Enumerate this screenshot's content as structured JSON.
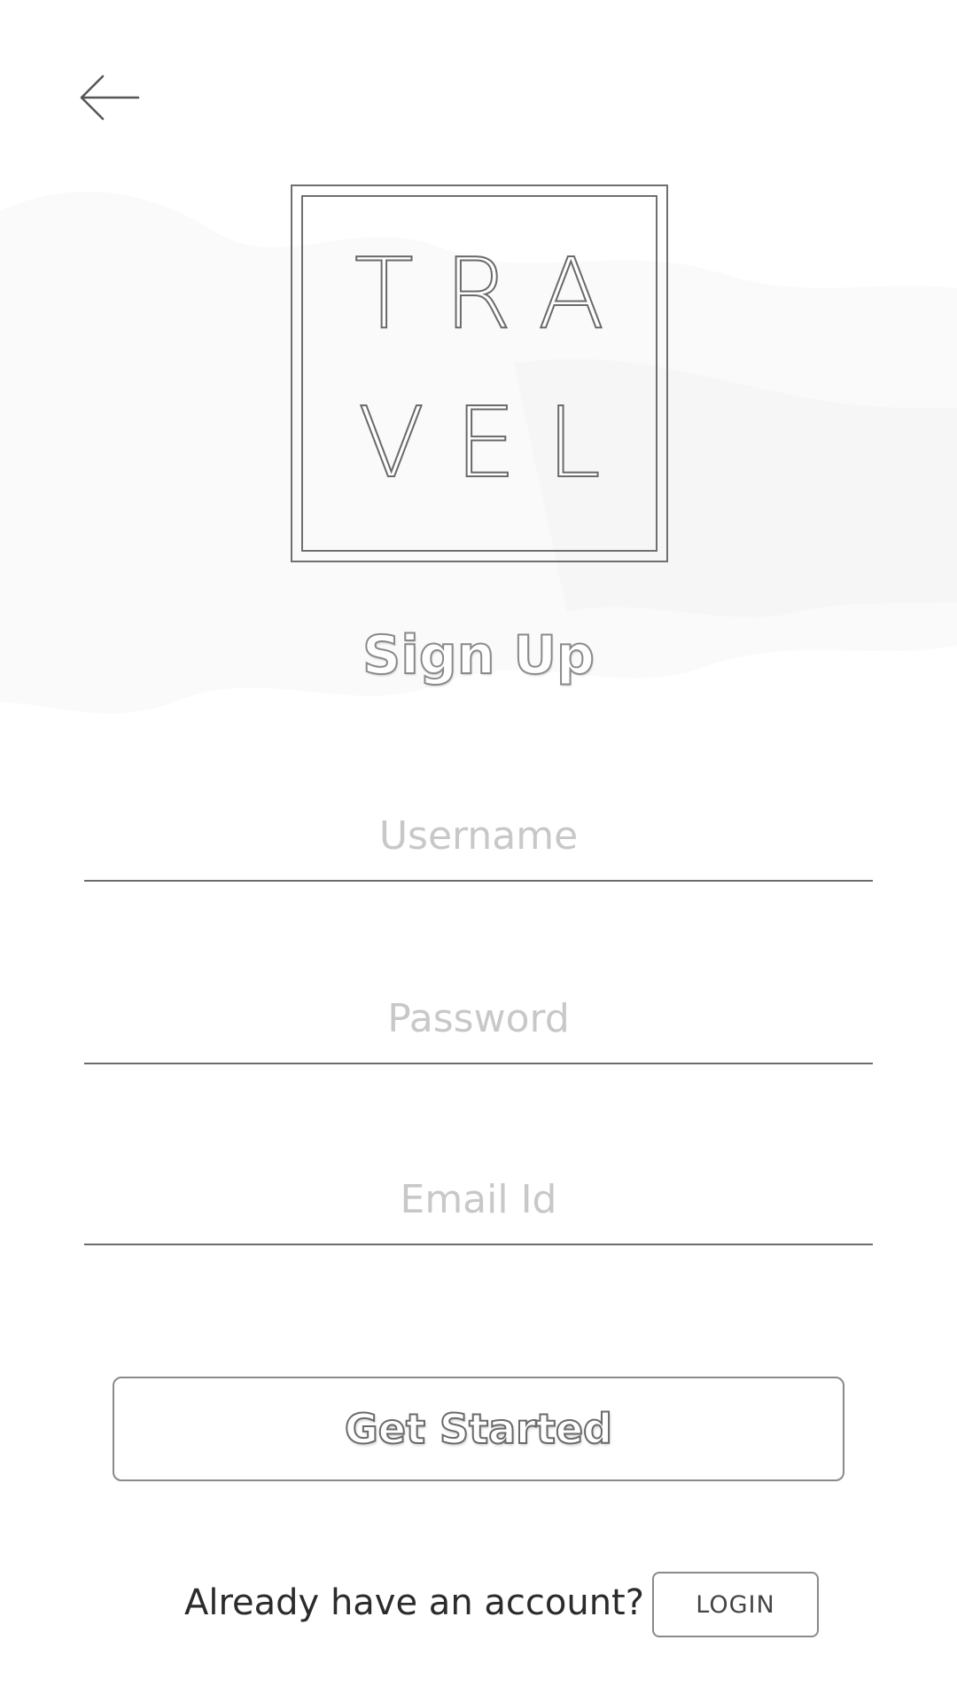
{
  "header": {
    "back_icon": "arrow-left-icon"
  },
  "logo": {
    "line1": "TRA",
    "line2": "VEL"
  },
  "title": "Sign Up",
  "form": {
    "username": {
      "placeholder": "Username",
      "value": ""
    },
    "password": {
      "placeholder": "Password",
      "value": ""
    },
    "email": {
      "placeholder": "Email Id",
      "value": ""
    }
  },
  "cta": {
    "label": "Get Started"
  },
  "footer": {
    "prompt": "Already have an account?",
    "login_label": "LOGIN"
  },
  "colors": {
    "background": "#ffffff",
    "line": "#6b6b6b",
    "placeholder": "#c8c8c8",
    "text": "#2b2b2b"
  }
}
